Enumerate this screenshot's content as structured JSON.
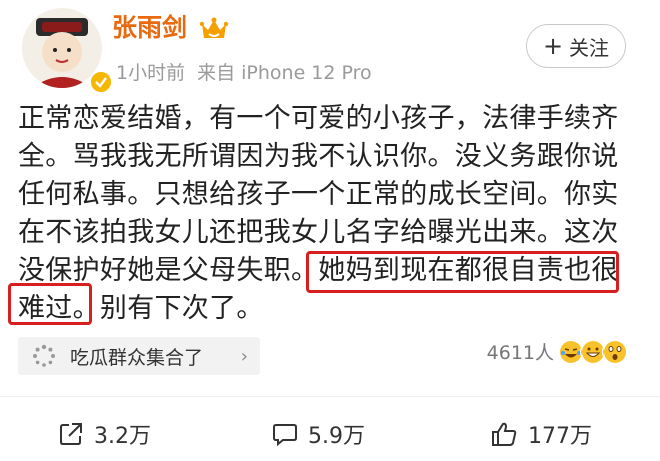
{
  "user": {
    "name": "张雨剑",
    "time": "1小时前",
    "source": "来自 iPhone 12 Pro"
  },
  "follow": {
    "label": "关注"
  },
  "post": {
    "lines": [
      "正常恋爱结婚，有一个可爱的小孩子，法律手续齐",
      "全。骂我我无所谓因为我不认识你。没义务跟你说",
      "任何私事。只想给孩子一个正常的成长空间。你实",
      "在不该拍我女儿还把我女儿名字给曝光出来。这次",
      "没保护好她是父母失职。她妈到现在都很自责也很",
      "难过。别有下次了。"
    ]
  },
  "topic": {
    "label": "吃瓜群众集合了"
  },
  "reactions": {
    "count": "4611人"
  },
  "actions": {
    "share": "3.2万",
    "comment": "5.9万",
    "like": "177万"
  },
  "colors": {
    "username": "#e86a10",
    "highlight": "#d81e1e",
    "verified": "#f5b700"
  }
}
